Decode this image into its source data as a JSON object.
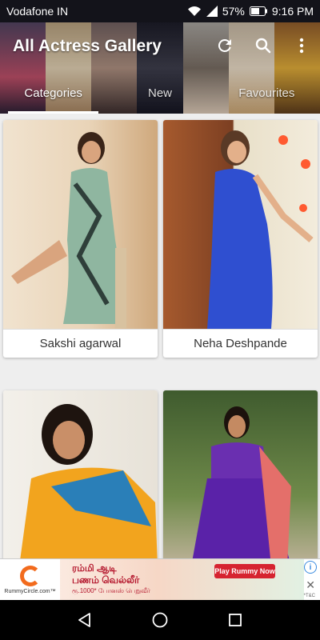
{
  "status_bar": {
    "carrier": "Vodafone IN",
    "battery": "57%",
    "time": "9:16 PM"
  },
  "app": {
    "title": "All Actress Gallery"
  },
  "toolbar": {
    "icons": [
      "refresh-icon",
      "search-icon",
      "more-vert-icon"
    ]
  },
  "tabs": [
    {
      "label": "Categories",
      "active": true
    },
    {
      "label": "New",
      "active": false
    },
    {
      "label": "Favourites",
      "active": false
    }
  ],
  "gallery": {
    "items": [
      {
        "name": "Sakshi agarwal"
      },
      {
        "name": "Neha Deshpande"
      },
      {
        "name": ""
      },
      {
        "name": ""
      }
    ]
  },
  "ad": {
    "brand": "RummyCircle.com™",
    "line1": "ரம்மி ஆடி",
    "line2": "பணம் வெல்லீர்",
    "line3": "ரூ.1000* போனஸ் பெறுவீர்",
    "cta": "Play Rummy Now",
    "tc": "*T&C"
  },
  "colors": {
    "tab_indicator": "#ffffff",
    "ad_cta": "#d62330",
    "background": "#eeeeee"
  }
}
